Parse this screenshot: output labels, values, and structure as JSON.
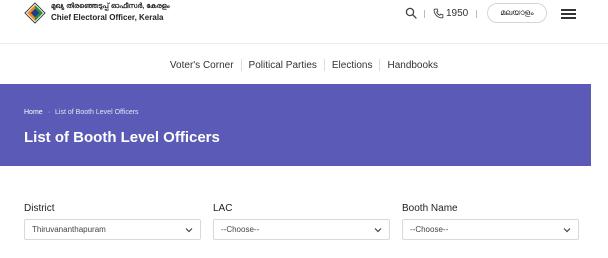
{
  "header": {
    "brand_malayalam": "മുഖ്യ തിരഞ്ഞെടുപ്പ് ഓഫീസർ, കേരളം",
    "brand_english": "Chief Electoral Officer, Kerala",
    "helpline": "1950",
    "language_button": "മലയാളം"
  },
  "icons": [
    "eci-logo-icon",
    "search-icon",
    "phone-icon",
    "menu-icon",
    "chevron-down-icon"
  ],
  "nav": {
    "items": [
      "Voter's Corner",
      "Political Parties",
      "Elections",
      "Handbooks"
    ]
  },
  "banner": {
    "breadcrumb_home": "Home",
    "breadcrumb_current": "List of Booth Level Officers",
    "title": "List of Booth Level Officers",
    "background_color": "#5b5bb7"
  },
  "form": {
    "district": {
      "label": "District",
      "value": "Thiruvananthapuram"
    },
    "lac": {
      "label": "LAC",
      "value": "--Choose--"
    },
    "booth": {
      "label": "Booth Name",
      "value": "--Choose--"
    }
  }
}
